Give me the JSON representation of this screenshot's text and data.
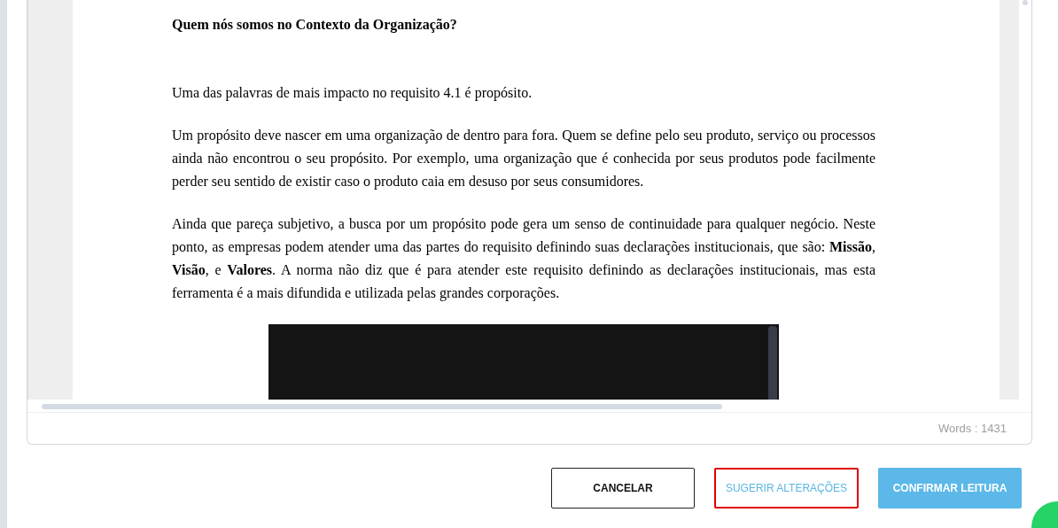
{
  "document": {
    "heading": "Quem nós somos no Contexto da Organização?",
    "paragraphs": [
      "Uma das palavras de mais impacto no requisito 4.1 é propósito.",
      "Um propósito deve nascer em uma organização de dentro para fora. Quem se define pelo seu produto, serviço ou processos ainda não encontrou o seu propósito. Por exemplo, uma organização que é conhecida por seus produtos pode facilmente perder seu sentido de existir caso o produto caia em desuso por seus consumidores.",
      "Ainda que pareça subjetivo, a busca por um propósito pode gera um senso de continuidade para qualquer negócio. Neste ponto, as empresas podem atender uma das partes do requisito definindo suas declarações institucionais, que são: **Missão**, **Visão**, e **Valores**. A norma não diz que é para atender este requisito definindo as declarações institucionais, mas esta ferramenta é a mais difundida e utilizada pelas grandes corporações."
    ],
    "embed": {
      "kind": "video"
    }
  },
  "word_count": "Words : 1431",
  "buttons": [
    {
      "label": "CANCELAR",
      "kind": "outline"
    },
    {
      "label": "SUGERIR ALTERAÇÕES",
      "kind": "highlighted"
    },
    {
      "label": "CONFIRMAR LEITURA",
      "kind": "primary"
    }
  ]
}
